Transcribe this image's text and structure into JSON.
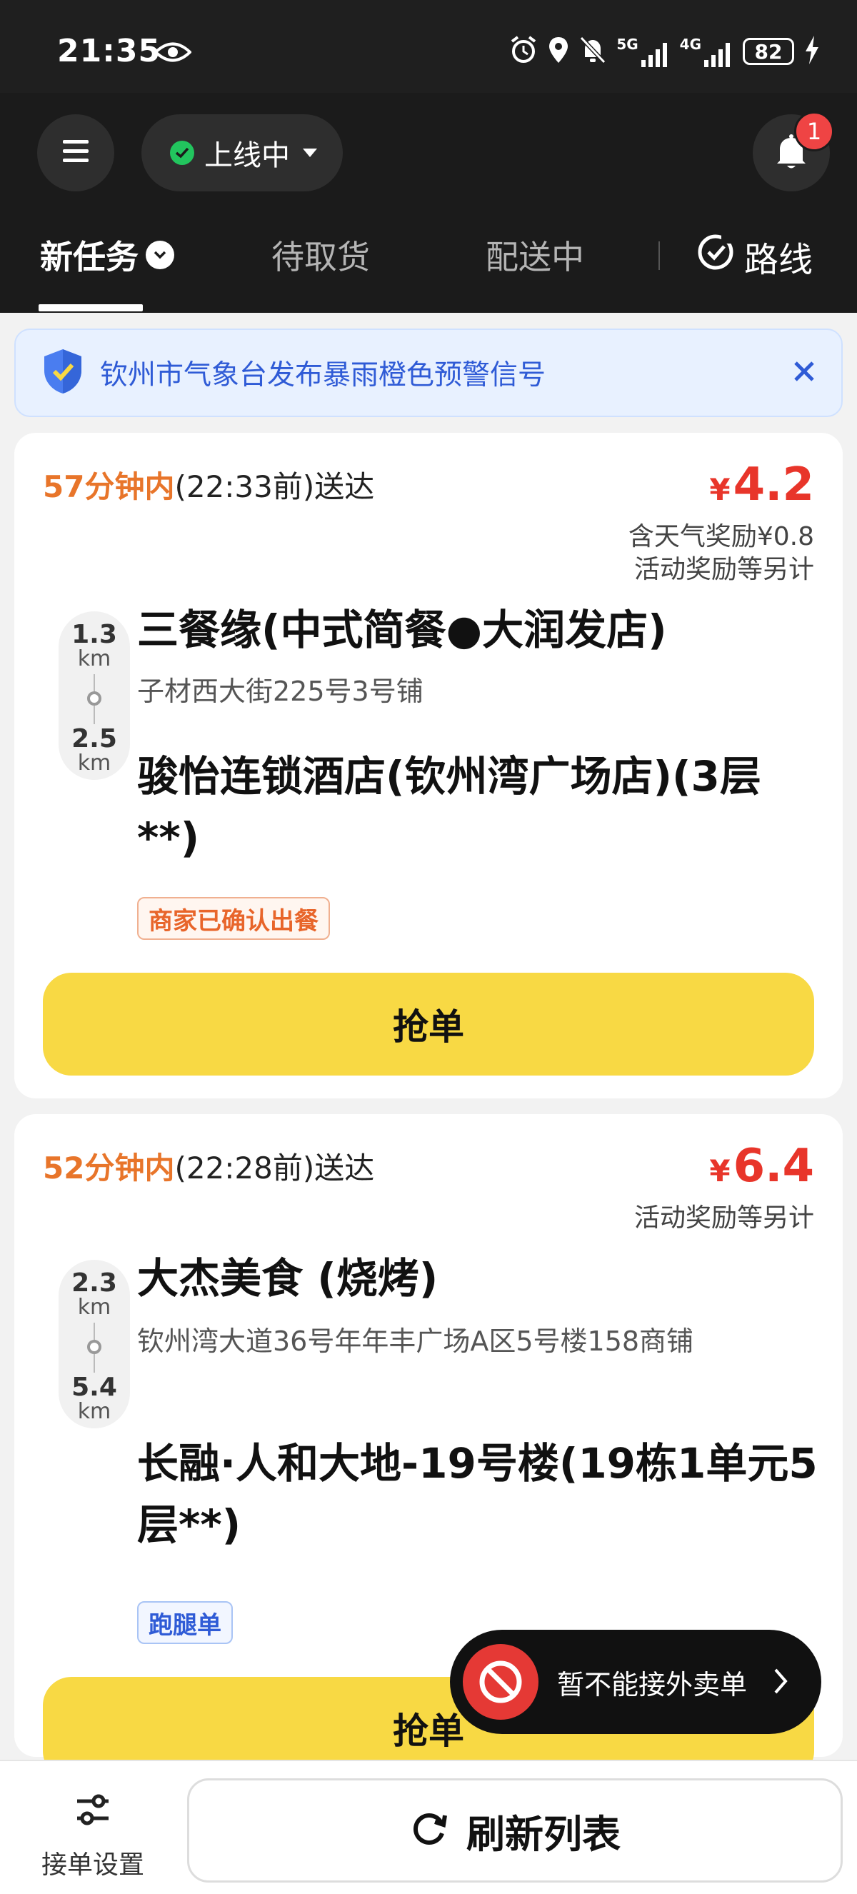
{
  "status_bar": {
    "time": "21:35",
    "network_1": "5G",
    "network_2": "4G",
    "battery": "82"
  },
  "topbar": {
    "online_status": "上线中",
    "notification_count": "1"
  },
  "tabs": {
    "new_tasks": "新任务",
    "pickup": "待取货",
    "delivering": "配送中",
    "route": "路线"
  },
  "alert": {
    "text": "钦州市气象台发布暴雨橙色预警信号"
  },
  "orders": [
    {
      "time_highlight": "57分钟内",
      "time_rest": "(22:33前)送达",
      "currency": "¥",
      "price": "4.2",
      "bonus_weather": "含天气奖励¥0.8",
      "bonus_activity": "活动奖励等另计",
      "dist_pickup": "1.3",
      "dist_pickup_unit": "km",
      "dist_dropoff": "2.5",
      "dist_dropoff_unit": "km",
      "shop_name": "三餐缘(中式简餐●大润发店)",
      "shop_address": "子材西大街225号3号铺",
      "destination": "骏怡连锁酒店(钦州湾广场店)(3层**)",
      "tag": "商家已确认出餐",
      "grab_label": "抢单"
    },
    {
      "time_highlight": "52分钟内",
      "time_rest": "(22:28前)送达",
      "currency": "¥",
      "price": "6.4",
      "bonus_activity": "活动奖励等另计",
      "dist_pickup": "2.3",
      "dist_pickup_unit": "km",
      "dist_dropoff": "5.4",
      "dist_dropoff_unit": "km",
      "shop_name": "大杰美食 (烧烤)",
      "shop_address": "钦州湾大道36号年年丰广场A区5号楼158商铺",
      "destination": "长融·人和大地-19号楼(19栋1单元5层**)",
      "tag": "跑腿单",
      "grab_label": "抢单"
    }
  ],
  "toast": {
    "text": "暂不能接外卖单"
  },
  "bottom": {
    "settings_label": "接单设置",
    "refresh_label": "刷新列表"
  },
  "colors": {
    "accent_yellow": "#f8d944",
    "price_red": "#e8352a",
    "time_orange": "#e8752a",
    "alert_blue": "#2f5bd6",
    "header_dark": "#1b1b1b"
  }
}
